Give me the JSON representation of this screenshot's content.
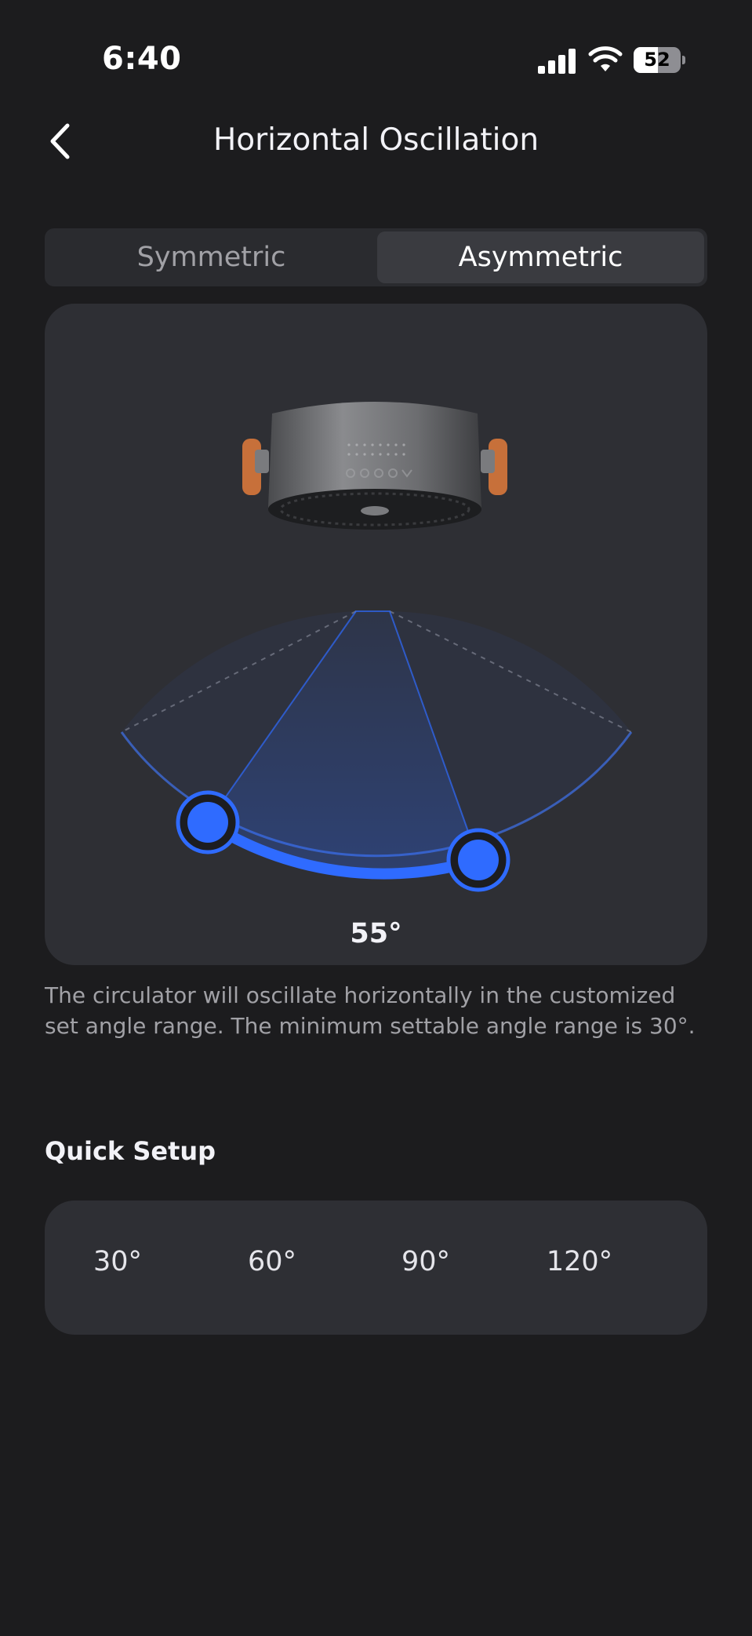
{
  "status_bar": {
    "time": "6:40",
    "battery": "52",
    "battery_level": 0.52,
    "signal_icon": "cellular-signal-icon",
    "wifi_icon": "wifi-icon"
  },
  "header": {
    "title": "Horizontal Oscillation",
    "back_icon": "chevron-left-icon"
  },
  "mode_tabs": {
    "items": [
      {
        "label": "Symmetric",
        "selected": false
      },
      {
        "label": "Asymmetric",
        "selected": true
      }
    ]
  },
  "oscillation": {
    "angle_text": "55°",
    "device_icon": "air-circulator-fan-icon",
    "range_color": "#2f6bff"
  },
  "description": "The circulator will oscillate horizontally in the customized set angle range. The minimum settable angle range is 30°.",
  "quick_setup": {
    "title": "Quick Setup",
    "options": [
      "30°",
      "60°",
      "90°",
      "120°"
    ]
  },
  "colors": {
    "background": "#1c1c1e",
    "card": "#2e2f34",
    "accent": "#2f6bff",
    "secondary_text": "#a1a1a6"
  }
}
